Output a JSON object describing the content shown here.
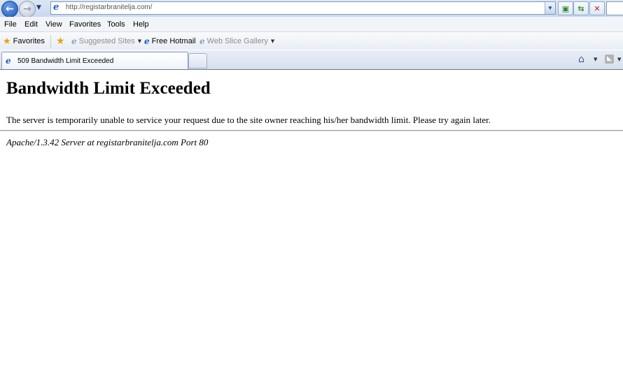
{
  "browser": {
    "address": {
      "url": "http://registarbranitelja.com/"
    },
    "menu": [
      "File",
      "Edit",
      "View",
      "Favorites",
      "Tools",
      "Help"
    ],
    "favorites_bar": {
      "favorites_label": "Favorites",
      "items": [
        {
          "label": "Suggested Sites",
          "has_dropdown": true,
          "disabled": true
        },
        {
          "label": "Free Hotmail",
          "has_dropdown": false,
          "disabled": false
        },
        {
          "label": "Web Slice Gallery",
          "has_dropdown": true,
          "disabled": true
        }
      ]
    },
    "tab": {
      "title": "509 Bandwidth Limit Exceeded"
    }
  },
  "page": {
    "heading": "Bandwidth Limit Exceeded",
    "message": "The server is temporarily unable to service your request due to the site owner reaching his/her bandwidth limit. Please try again later.",
    "server_signature": "Apache/1.3.42 Server at registarbranitelja.com Port 80"
  },
  "icons": {
    "back": "back-arrow-icon",
    "forward": "forward-arrow-icon",
    "compat": "compatibility-view-icon",
    "refresh": "refresh-icon",
    "stop": "stop-icon",
    "home": "home-icon",
    "feeds": "feeds-icon"
  },
  "colors": {
    "chrome_bg": "#dbe6f4",
    "menu_bg": "#f2f4f7",
    "link_blue": "#1f5bb8",
    "stop_red": "#c21f1f",
    "refresh_green": "#2d8f2d"
  }
}
